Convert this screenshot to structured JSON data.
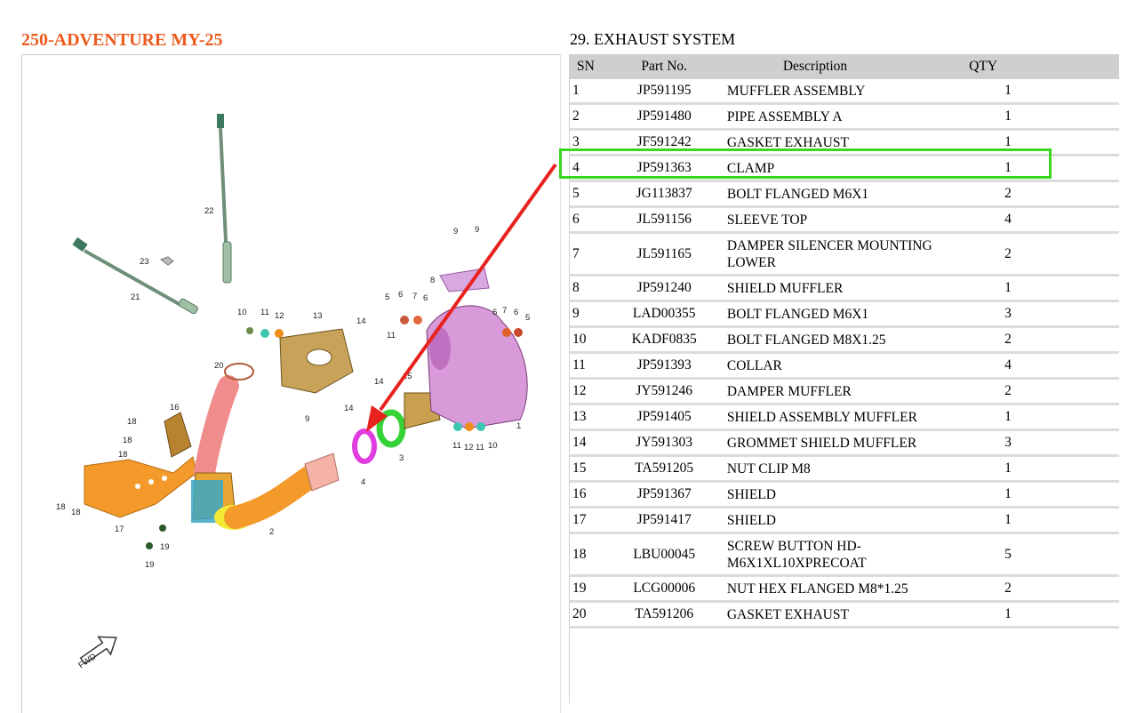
{
  "model_title": "250-ADVENTURE MY-25",
  "section_title": "29. EXHAUST SYSTEM",
  "diagram": {
    "fwd_label": "FWD",
    "callouts": [
      "1",
      "2",
      "3",
      "4",
      "5",
      "6",
      "7",
      "8",
      "9",
      "10",
      "11",
      "12",
      "13",
      "14",
      "15",
      "16",
      "17",
      "18",
      "19",
      "20",
      "21",
      "22",
      "23"
    ]
  },
  "table": {
    "headers": {
      "sn": "SN",
      "part_no": "Part No.",
      "description": "Description",
      "qty": "QTY"
    },
    "rows": [
      {
        "sn": "1",
        "part_no": "JP591195",
        "description": "MUFFLER ASSEMBLY",
        "qty": "1"
      },
      {
        "sn": "2",
        "part_no": "JP591480",
        "description": "PIPE ASSEMBLY A",
        "qty": "1"
      },
      {
        "sn": "3",
        "part_no": "JF591242",
        "description": "GASKET EXHAUST",
        "qty": "1"
      },
      {
        "sn": "4",
        "part_no": "JP591363",
        "description": "CLAMP",
        "qty": "1"
      },
      {
        "sn": "5",
        "part_no": "JG113837",
        "description": "BOLT FLANGED M6X1",
        "qty": "2"
      },
      {
        "sn": "6",
        "part_no": "JL591156",
        "description": "SLEEVE TOP",
        "qty": "4"
      },
      {
        "sn": "7",
        "part_no": "JL591165",
        "description": "DAMPER SILENCER MOUNTING LOWER",
        "qty": "2"
      },
      {
        "sn": "8",
        "part_no": "JP591240",
        "description": "SHIELD MUFFLER",
        "qty": "1"
      },
      {
        "sn": "9",
        "part_no": "LAD00355",
        "description": "BOLT FLANGED M6X1",
        "qty": "3"
      },
      {
        "sn": "10",
        "part_no": "KADF0835",
        "description": "BOLT FLANGED M8X1.25",
        "qty": "2"
      },
      {
        "sn": "11",
        "part_no": "JP591393",
        "description": "COLLAR",
        "qty": "4"
      },
      {
        "sn": "12",
        "part_no": "JY591246",
        "description": "DAMPER MUFFLER",
        "qty": "2"
      },
      {
        "sn": "13",
        "part_no": "JP591405",
        "description": "SHIELD ASSEMBLY MUFFLER",
        "qty": "1"
      },
      {
        "sn": "14",
        "part_no": "JY591303",
        "description": "GROMMET SHIELD MUFFLER",
        "qty": "3"
      },
      {
        "sn": "15",
        "part_no": "TA591205",
        "description": "NUT CLIP M8",
        "qty": "1"
      },
      {
        "sn": "16",
        "part_no": "JP591367",
        "description": "SHIELD",
        "qty": "1"
      },
      {
        "sn": "17",
        "part_no": "JP591417",
        "description": "SHIELD",
        "qty": "1"
      },
      {
        "sn": "18",
        "part_no": "LBU00045",
        "description": "SCREW BUTTON HD-M6X1XL10XPRECOAT",
        "qty": "5"
      },
      {
        "sn": "19",
        "part_no": "LCG00006",
        "description": "NUT HEX FLANGED M8*1.25",
        "qty": "2"
      },
      {
        "sn": "20",
        "part_no": "TA591206",
        "description": "GASKET EXHAUST",
        "qty": "1"
      }
    ]
  },
  "highlight": {
    "row_sn": "4",
    "box_color": "#3ad81d",
    "arrow_color": "#e8231f"
  },
  "colors": {
    "title": "#ec5a1e",
    "header_bg": "#cfcfcf"
  }
}
